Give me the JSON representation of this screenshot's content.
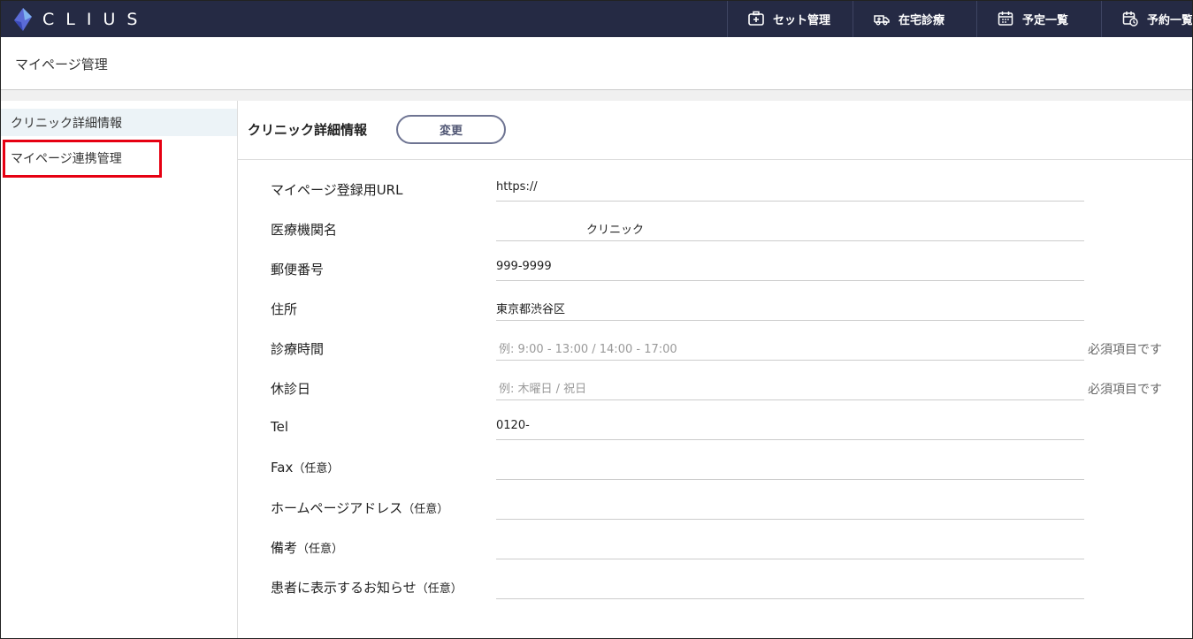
{
  "app": {
    "logo_text": "CLIUS",
    "nav": [
      {
        "label": "セット管理",
        "icon": "medical-bag-icon"
      },
      {
        "label": "在宅診療",
        "icon": "ambulance-icon"
      },
      {
        "label": "予定一覧",
        "icon": "calendar-icon"
      },
      {
        "label": "予約一覧",
        "icon": "calendar-clock-icon"
      }
    ]
  },
  "page": {
    "title": "マイページ管理"
  },
  "sidebar": {
    "items": [
      {
        "label": "クリニック詳細情報",
        "active": true
      },
      {
        "label": "マイページ連携管理",
        "active": false
      }
    ],
    "highlight_color": "#e60012"
  },
  "main": {
    "section_title": "クリニック詳細情報",
    "change_button": "変更",
    "fields": [
      {
        "label": "マイページ登録用URL",
        "optional": "",
        "value": "https://",
        "placeholder": "",
        "required_note": ""
      },
      {
        "label": "医療機関名",
        "optional": "",
        "value": "クリニック",
        "placeholder": "",
        "required_note": ""
      },
      {
        "label": "郵便番号",
        "optional": "",
        "value": "999-9999",
        "placeholder": "",
        "required_note": ""
      },
      {
        "label": "住所",
        "optional": "",
        "value": "東京都渋谷区",
        "placeholder": "",
        "required_note": ""
      },
      {
        "label": "診療時間",
        "optional": "",
        "value": "",
        "placeholder": "例: 9:00 - 13:00 / 14:00 - 17:00",
        "required_note": "必須項目です"
      },
      {
        "label": "休診日",
        "optional": "",
        "value": "",
        "placeholder": "例: 木曜日 / 祝日",
        "required_note": "必須項目です"
      },
      {
        "label": "Tel",
        "optional": "",
        "value": "0120-",
        "placeholder": "",
        "required_note": ""
      },
      {
        "label": "Fax",
        "optional": "（任意）",
        "value": "",
        "placeholder": "",
        "required_note": ""
      },
      {
        "label": "ホームページアドレス",
        "optional": "（任意）",
        "value": "",
        "placeholder": "",
        "required_note": ""
      },
      {
        "label": "備考",
        "optional": "（任意）",
        "value": "",
        "placeholder": "",
        "required_note": ""
      },
      {
        "label": "患者に表示するお知らせ",
        "optional": "（任意）",
        "value": "",
        "placeholder": "",
        "required_note": ""
      }
    ]
  },
  "colors": {
    "header_bg": "#252a44",
    "accent_logo": "#4a7bd8",
    "button_border": "#6e7492"
  }
}
